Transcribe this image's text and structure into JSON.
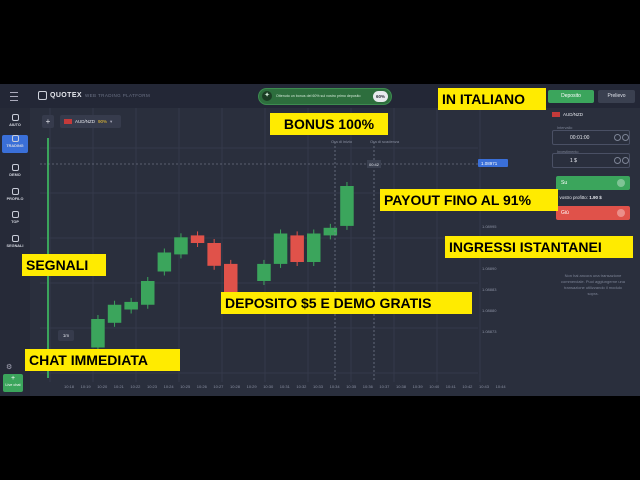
{
  "header": {
    "brand": "QUOTEX",
    "tagline": "WEB TRADING PLATFORM",
    "promo_text": "Ottenuto un bonus del 60% sul vostro primo deposito",
    "promo_badge": "60%",
    "deposit_label": "Deposito",
    "withdraw_label": "Prelievo"
  },
  "sidebar": {
    "items": [
      {
        "label": "AIUTO",
        "icon": "help-icon"
      },
      {
        "label": "TRADING",
        "icon": "chart-icon"
      },
      {
        "label": "DEMO",
        "icon": "demo-icon"
      },
      {
        "label": "PROFILO",
        "icon": "user-icon"
      },
      {
        "label": "TOP",
        "icon": "trophy-icon"
      },
      {
        "label": "SEGNALI",
        "icon": "signal-icon"
      }
    ],
    "chat_label": "Live chat"
  },
  "chart": {
    "asset": "AUD/NZD",
    "payout": "90%",
    "timeframe": "1m",
    "price_tag": "1.08971",
    "current_marker": "00:42",
    "start_label": "Ora di inizio",
    "expiry_label": "Ora di scadenza",
    "y_ticks": [
      "1.08995",
      "1.08993",
      "1.08890",
      "1.08883",
      "1.08880",
      "1.08873"
    ],
    "x_ticks": [
      "10:18",
      "10:19",
      "10:20",
      "10:21",
      "10:22",
      "10:23",
      "10:24",
      "10:25",
      "10:26",
      "10:27",
      "10:28",
      "10:29",
      "10:30",
      "10:31",
      "10:32",
      "10:33",
      "10:34",
      "10:35",
      "10:36",
      "10:37",
      "10:38",
      "10:39",
      "10:40",
      "10:41",
      "10:42",
      "10:43",
      "10:44"
    ],
    "candles": [
      {
        "o": 10,
        "c": 18
      },
      {
        "o": 20,
        "c": 12
      },
      {
        "o": 30,
        "c": 60
      },
      {
        "o": 56,
        "c": 75
      },
      {
        "o": 70,
        "c": 78
      },
      {
        "o": 75,
        "c": 100
      },
      {
        "o": 110,
        "c": 130
      },
      {
        "o": 128,
        "c": 146
      },
      {
        "o": 148,
        "c": 140
      },
      {
        "o": 140,
        "c": 116
      },
      {
        "o": 118,
        "c": 75
      },
      {
        "o": 80,
        "c": 70
      },
      {
        "o": 100,
        "c": 118
      },
      {
        "o": 118,
        "c": 150
      },
      {
        "o": 148,
        "c": 120
      },
      {
        "o": 120,
        "c": 150
      },
      {
        "o": 148,
        "c": 156
      },
      {
        "o": 158,
        "c": 200
      }
    ],
    "colors": {
      "up": "#3ba55c",
      "down": "#e0524a",
      "bg": "#2a2f3d"
    }
  },
  "panel": {
    "asset": "AUD/NZD",
    "time_label": "Intervallo",
    "time_value": "00:01:00",
    "amount_label": "Investimento",
    "amount_value": "1 $",
    "up_label": "Su",
    "profit_label": "Il vostro profitto:",
    "profit_value": "1.90 $",
    "down_label": "Giù",
    "info_text": "Non hai ancora una transazione commerciale. Puoi aggiungerne una transazione utilizzando il modulo sopra."
  },
  "overlays": {
    "italiano": "IN ITALIANO",
    "bonus": "BONUS 100%",
    "payout": "PAYOUT FINO AL 91%",
    "ingressi": "INGRESSI ISTANTANEI",
    "segnali": "SEGNALI",
    "deposito": "DEPOSITO $5 E DEMO GRATIS",
    "chat": "CHAT IMMEDIATA"
  }
}
